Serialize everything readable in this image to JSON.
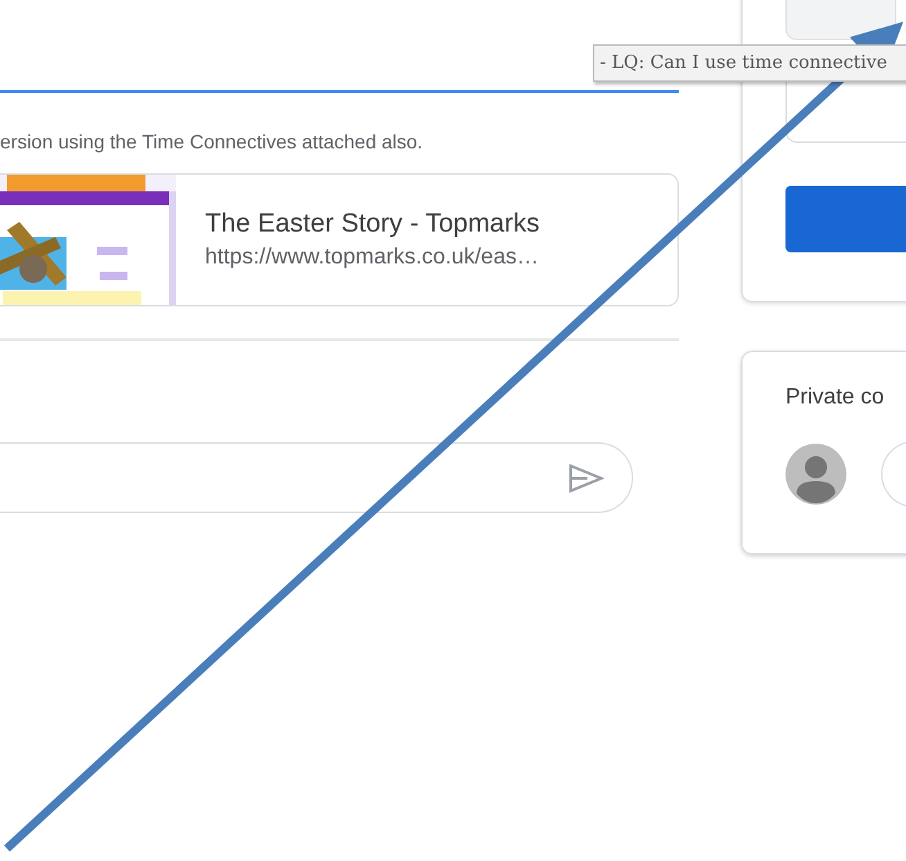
{
  "tooltip": {
    "text": "- LQ: Can I use time connective"
  },
  "post": {
    "text": "ersion using the Time Connectives attached also.",
    "attachment": {
      "kind": "picture",
      "title": "The Easter Story - Topmarks",
      "url": "https://www.topmarks.co.uk/eas…"
    }
  },
  "private_comments": {
    "title": "Private co"
  }
}
